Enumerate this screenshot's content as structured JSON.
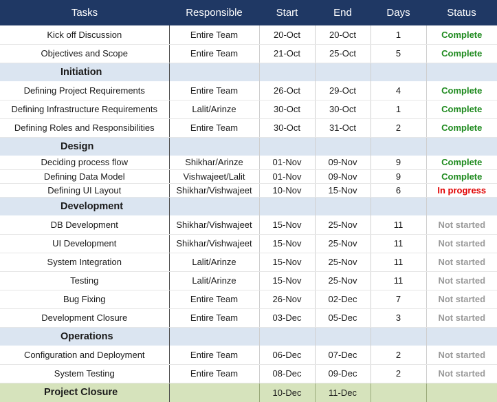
{
  "headers": {
    "task": "Tasks",
    "responsible": "Responsible",
    "start": "Start",
    "end": "End",
    "days": "Days",
    "status": "Status"
  },
  "status_colors": {
    "complete": "#1e8a1e",
    "in_progress": "#e00000",
    "not_started": "#9a9a9a"
  },
  "rows": [
    {
      "kind": "task",
      "task": "Kick off Discussion",
      "responsible": "Entire Team",
      "start": "20-Oct",
      "end": "20-Oct",
      "days": "1",
      "status": "Complete",
      "status_key": "complete"
    },
    {
      "kind": "task",
      "task": "Objectives and Scope",
      "responsible": "Entire Team",
      "start": "21-Oct",
      "end": "25-Oct",
      "days": "5",
      "status": "Complete",
      "status_key": "complete"
    },
    {
      "kind": "phase",
      "name": "Initiation"
    },
    {
      "kind": "task",
      "task": "Defining Project Requirements",
      "responsible": "Entire Team",
      "start": "26-Oct",
      "end": "29-Oct",
      "days": "4",
      "status": "Complete",
      "status_key": "complete"
    },
    {
      "kind": "task",
      "task": "Defining Infrastructure Requirements",
      "responsible": "Lalit/Arinze",
      "start": "30-Oct",
      "end": "30-Oct",
      "days": "1",
      "status": "Complete",
      "status_key": "complete"
    },
    {
      "kind": "task",
      "task": "Defining Roles and Responsibilities",
      "responsible": "Entire Team",
      "start": "30-Oct",
      "end": "31-Oct",
      "days": "2",
      "status": "Complete",
      "status_key": "complete"
    },
    {
      "kind": "phase",
      "name": "Design"
    },
    {
      "kind": "task",
      "task": "Deciding process flow",
      "responsible": "Shikhar/Arinze",
      "start": "01-Nov",
      "end": "09-Nov",
      "days": "9",
      "status": "Complete",
      "status_key": "complete",
      "compact": true
    },
    {
      "kind": "task",
      "task": "Defining Data Model",
      "responsible": "Vishwajeet/Lalit",
      "start": "01-Nov",
      "end": "09-Nov",
      "days": "9",
      "status": "Complete",
      "status_key": "complete",
      "compact": true
    },
    {
      "kind": "task",
      "task": "Defining UI Layout",
      "responsible": "Shikhar/Vishwajeet",
      "start": "10-Nov",
      "end": "15-Nov",
      "days": "6",
      "status": "In progress",
      "status_key": "progress",
      "compact": true
    },
    {
      "kind": "phase",
      "name": "Development"
    },
    {
      "kind": "task",
      "task": "DB Development",
      "responsible": "Shikhar/Vishwajeet",
      "start": "15-Nov",
      "end": "25-Nov",
      "days": "11",
      "status": "Not started",
      "status_key": "notstarted"
    },
    {
      "kind": "task",
      "task": "UI Development",
      "responsible": "Shikhar/Vishwajeet",
      "start": "15-Nov",
      "end": "25-Nov",
      "days": "11",
      "status": "Not started",
      "status_key": "notstarted"
    },
    {
      "kind": "task",
      "task": "System Integration",
      "responsible": "Lalit/Arinze",
      "start": "15-Nov",
      "end": "25-Nov",
      "days": "11",
      "status": "Not started",
      "status_key": "notstarted"
    },
    {
      "kind": "task",
      "task": "Testing",
      "responsible": "Lalit/Arinze",
      "start": "15-Nov",
      "end": "25-Nov",
      "days": "11",
      "status": "Not started",
      "status_key": "notstarted"
    },
    {
      "kind": "task",
      "task": "Bug Fixing",
      "responsible": "Entire Team",
      "start": "26-Nov",
      "end": "02-Dec",
      "days": "7",
      "status": "Not started",
      "status_key": "notstarted"
    },
    {
      "kind": "task",
      "task": "Development Closure",
      "responsible": "Entire Team",
      "start": "03-Dec",
      "end": "05-Dec",
      "days": "3",
      "status": "Not started",
      "status_key": "notstarted"
    },
    {
      "kind": "phase",
      "name": "Operations"
    },
    {
      "kind": "task",
      "task": "Configuration and Deployment",
      "responsible": "Entire Team",
      "start": "06-Dec",
      "end": "07-Dec",
      "days": "2",
      "status": "Not started",
      "status_key": "notstarted"
    },
    {
      "kind": "task",
      "task": "System Testing",
      "responsible": "Entire Team",
      "start": "08-Dec",
      "end": "09-Dec",
      "days": "2",
      "status": "Not started",
      "status_key": "notstarted"
    },
    {
      "kind": "closure",
      "name": "Project Closure",
      "start": "10-Dec",
      "end": "11-Dec"
    }
  ]
}
